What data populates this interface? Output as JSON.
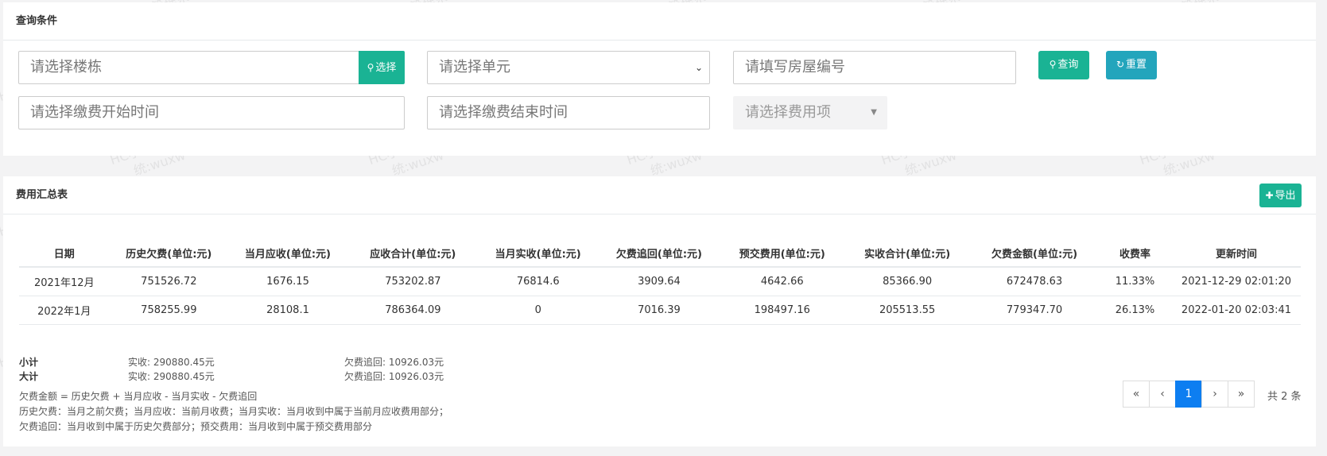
{
  "query": {
    "title": "查询条件",
    "building_placeholder": "请选择楼栋",
    "select_button": "选择",
    "unit_placeholder": "请选择单元",
    "room_placeholder": "请填写房屋编号",
    "search_button": "查询",
    "reset_button": "重置",
    "start_time_placeholder": "请选择缴费开始时间",
    "end_time_placeholder": "请选择缴费结束时间",
    "fee_item_placeholder": "请选择费用项"
  },
  "summary": {
    "title": "费用汇总表",
    "export_button": "导出",
    "columns": [
      "日期",
      "历史欠费(单位:元)",
      "当月应收(单位:元)",
      "应收合计(单位:元)",
      "当月实收(单位:元)",
      "欠费追回(单位:元)",
      "预交费用(单位:元)",
      "实收合计(单位:元)",
      "欠费金额(单位:元)",
      "收费率",
      "更新时间"
    ],
    "rows": [
      [
        "2021年12月",
        "751526.72",
        "1676.15",
        "753202.87",
        "76814.6",
        "3909.64",
        "4642.66",
        "85366.90",
        "672478.63",
        "11.33%",
        "2021-12-29 02:01:20"
      ],
      [
        "2022年1月",
        "758255.99",
        "28108.1",
        "786364.09",
        "0",
        "7016.39",
        "198497.16",
        "205513.55",
        "779347.70",
        "26.13%",
        "2022-01-20 02:03:41"
      ]
    ],
    "subtotal": {
      "label": "小计",
      "received": "实收: 290880.45元",
      "recovered": "欠费追回: 10926.03元"
    },
    "total": {
      "label": "大计",
      "received": "实收: 290880.45元",
      "recovered": "欠费追回: 10926.03元"
    },
    "notes": [
      "欠费金额 = 历史欠费 + 当月应收 - 当月实收 - 欠费追回",
      "历史欠费：当月之前欠费；当月应收：当前月收费；当月实收：当月收到中属于当前月应收费用部分；",
      "欠费追回：当月收到中属于历史欠费部分；预交费用：当月收到中属于预交费用部分"
    ]
  },
  "pagination": {
    "first": "«",
    "prev": "‹",
    "current": "1",
    "next": "›",
    "last": "»",
    "total_text": "共 2 条"
  },
  "watermark": {
    "line1": "HC小区管理系",
    "line2": "统:wuxw"
  }
}
